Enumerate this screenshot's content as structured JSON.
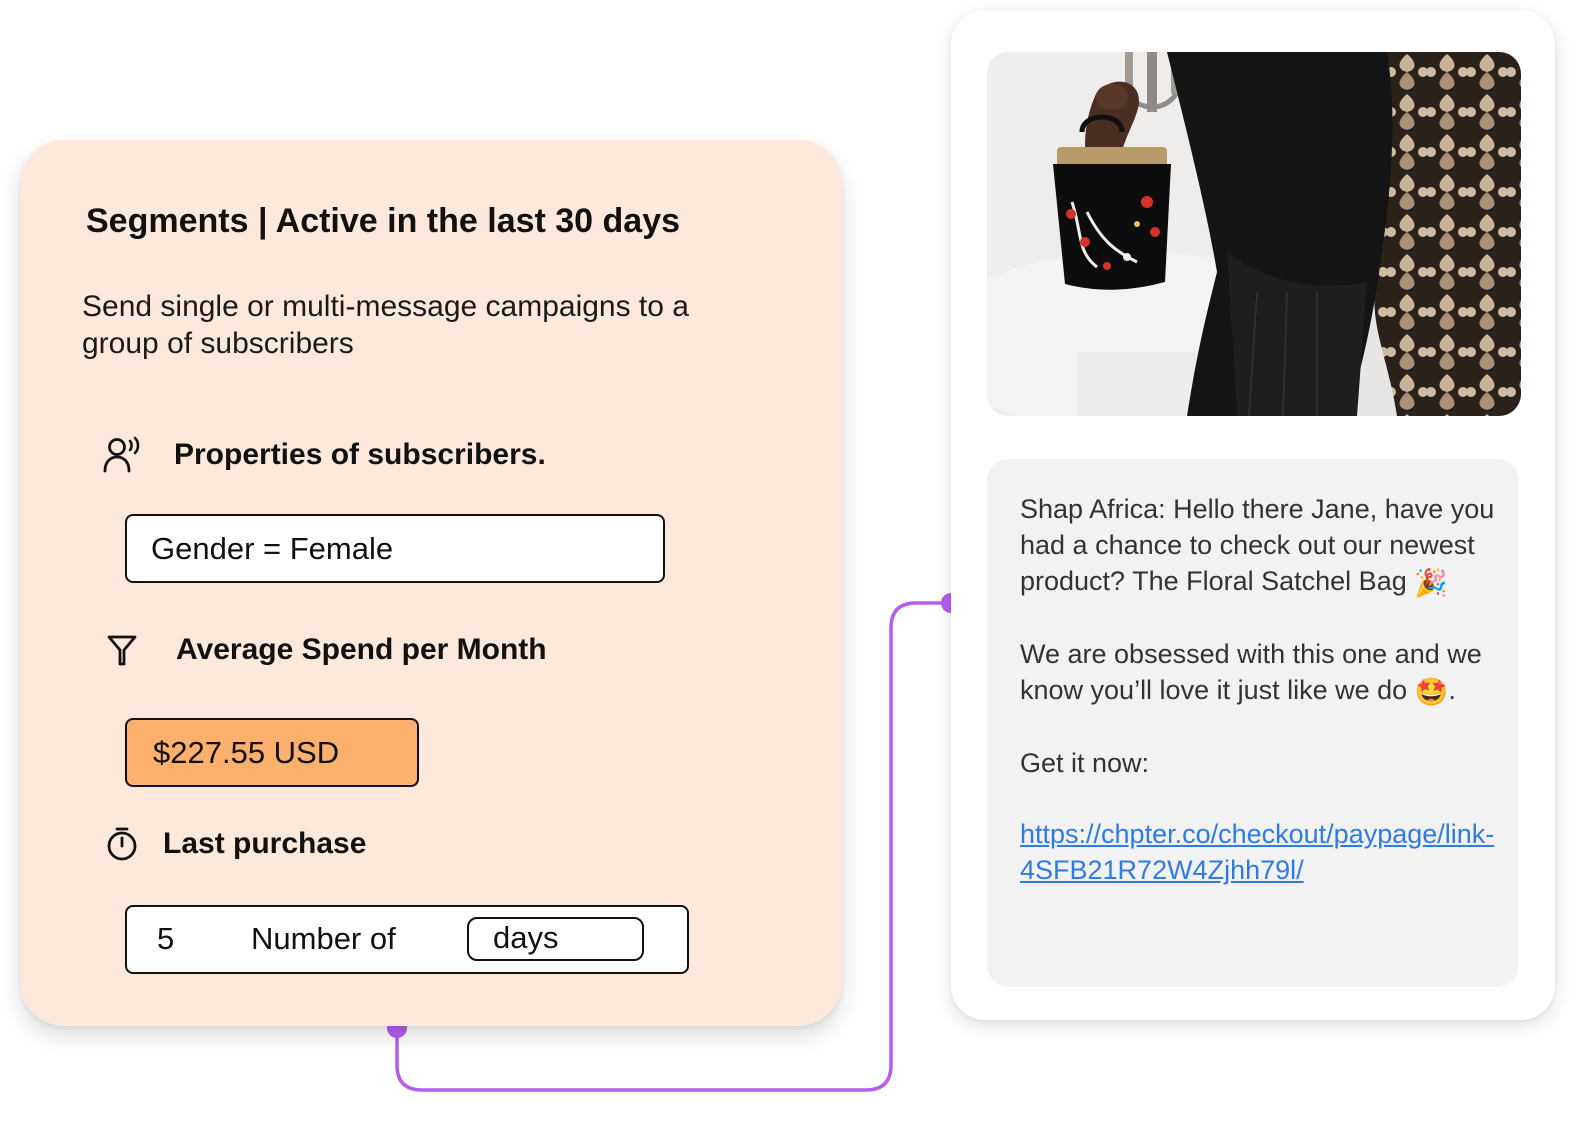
{
  "segment": {
    "title": "Segments | Active in the last 30 days",
    "description": "Send single or multi-message campaigns to a group of subscribers",
    "properties": {
      "label": "Properties of subscribers.",
      "icon": "user-voice-icon",
      "value": "Gender = Female"
    },
    "spend": {
      "label": "Average Spend per Month",
      "icon": "filter-icon",
      "value": "$227.55 USD",
      "highlight_color": "#fbb06e"
    },
    "last_purchase": {
      "label": "Last purchase",
      "icon": "stopwatch-icon",
      "number": "5",
      "number_label": "Number of",
      "unit": "days"
    },
    "card_color": "#fde9dc"
  },
  "message": {
    "image": "woman-holding-floral-satchel-bag-photo",
    "paragraph1": "Shap Africa: Hello there Jane, have you had a chance to check out our newest product? The Floral Satchel Bag",
    "paragraph1_emoji": "🎉",
    "paragraph2": "We are obsessed with this one and we know you’ll love it just like we do",
    "paragraph2_emoji": "🤩",
    "paragraph2_end": ".",
    "paragraph3": "Get it now:",
    "link": "https://chpter.co/checkout/paypage/link-4SFB21R72W4Zjhh79l/",
    "link_color": "#2f7be5"
  },
  "connector_color": "#b45ef0"
}
